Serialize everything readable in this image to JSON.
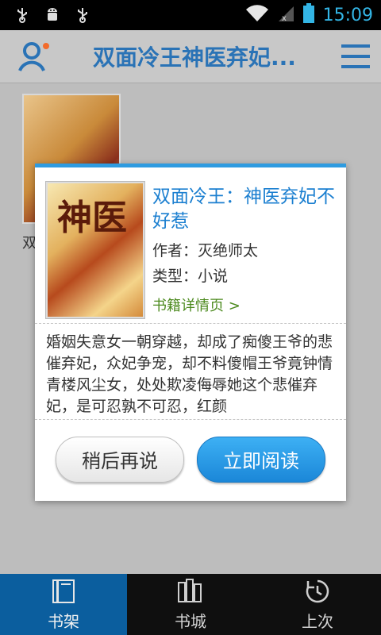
{
  "status_bar": {
    "time": "15:09",
    "icons": [
      "usb-icon",
      "android-debug-icon",
      "usb-icon",
      "wifi-icon",
      "signal-icon",
      "battery-icon"
    ]
  },
  "header": {
    "title": "双面冷王神医弃妃...",
    "user_icon": "user-icon",
    "menu_icon": "menu-icon"
  },
  "background": {
    "shelf_label": "双"
  },
  "dialog": {
    "title": "双面冷王：神医弃妃不好惹",
    "author": "作者：灭绝师太",
    "type": "类型：小说",
    "detail_link": "书籍详情页 >",
    "synopsis": "婚姻失意女一朝穿越，却成了痴傻王爷的悲催弃妃，众妃争宠，却不料傻帽王爷竟钟情青楼风尘女，处处欺凌侮辱她这个悲催弃妃，是可忍孰不可忍，红颜",
    "cover_text": "神医",
    "buttons": {
      "later": "稍后再说",
      "read": "立即阅读"
    },
    "accent_color": "#2e9be0"
  },
  "bottom_nav": [
    {
      "label": "书架",
      "icon": "bookshelf-icon",
      "active": true
    },
    {
      "label": "书城",
      "icon": "bookstore-icon",
      "active": false
    },
    {
      "label": "上次",
      "icon": "history-icon",
      "active": false
    }
  ]
}
